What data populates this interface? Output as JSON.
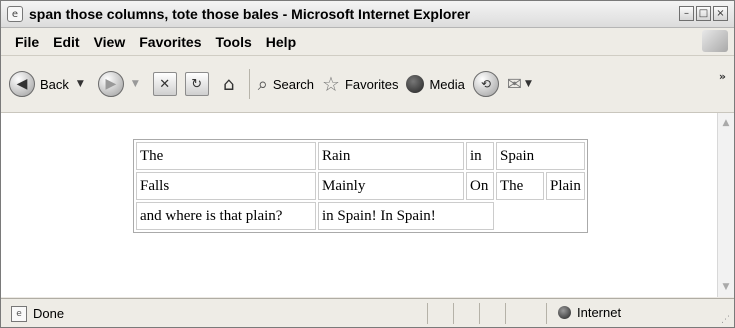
{
  "window": {
    "title": "span those columns, tote those bales - Microsoft Internet Explorer",
    "controls": [
      "minimize",
      "maximize",
      "close"
    ]
  },
  "menu": {
    "items": [
      "File",
      "Edit",
      "View",
      "Favorites",
      "Tools",
      "Help"
    ]
  },
  "toolbar": {
    "back_label": "Back",
    "search_label": "Search",
    "favorites_label": "Favorites",
    "media_label": "Media",
    "icons": [
      "back-arrow-icon",
      "forward-arrow-icon",
      "stop-icon",
      "refresh-icon",
      "home-icon",
      "search-icon",
      "favorites-star-icon",
      "media-icon",
      "history-icon",
      "mail-icon"
    ]
  },
  "page": {
    "table": {
      "rows": [
        [
          "The",
          "Rain",
          "in",
          "Spain"
        ],
        [
          "Falls",
          "Mainly",
          "On",
          "The",
          "Plain"
        ],
        [
          "and where is that plain?",
          "in Spain! In Spain!"
        ]
      ]
    }
  },
  "status": {
    "text": "Done",
    "zone": "Internet"
  }
}
